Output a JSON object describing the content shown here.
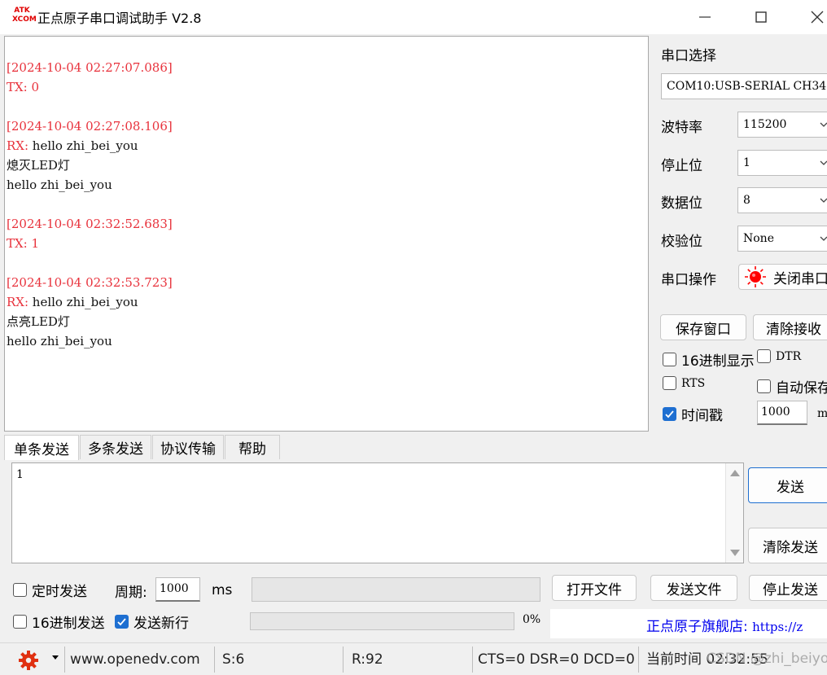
{
  "window": {
    "logo_line1": "ATK",
    "logo_line2": "XCOM",
    "title": "正点原子串口调试助手 V2.8"
  },
  "receive_log": [
    {
      "text": "[2024-10-04 02:27:07.086]",
      "color": "red"
    },
    {
      "text": "TX: 0",
      "color": "red"
    },
    {
      "text": "[2024-10-04 02:27:08.106]",
      "color": "red"
    },
    {
      "label": "RX:",
      "text": " hello zhi_bei_you"
    },
    {
      "text": "熄灭LED灯",
      "color": "black"
    },
    {
      "text": "hello zhi_bei_you",
      "color": "black"
    },
    {
      "text": "[2024-10-04 02:32:52.683]",
      "color": "red"
    },
    {
      "text": "TX: 1",
      "color": "red"
    },
    {
      "text": "[2024-10-04 02:32:53.723]",
      "color": "red"
    },
    {
      "label": "RX:",
      "text": " hello zhi_bei_you"
    },
    {
      "text": "点亮LED灯",
      "color": "black"
    },
    {
      "text": "hello zhi_bei_you",
      "color": "black"
    }
  ],
  "serial": {
    "port_label": "串口选择",
    "port_value": "COM10:USB-SERIAL CH34",
    "baud_label": "波特率",
    "baud_value": "115200",
    "stop_label": "停止位",
    "stop_value": "1",
    "data_label": "数据位",
    "data_value": "8",
    "parity_label": "校验位",
    "parity_value": "None",
    "op_label": "串口操作",
    "op_button": "关闭串口"
  },
  "rx_controls": {
    "save_window": "保存窗口",
    "clear_receive": "清除接收",
    "hex_display": "16进制显示",
    "dtr": "DTR",
    "rts": "RTS",
    "auto_save": "自动保存",
    "timestamp": "时间戳",
    "timestamp_value": "1000",
    "timestamp_unit": "ms"
  },
  "tabs": [
    "单条发送",
    "多条发送",
    "协议传输",
    "帮助"
  ],
  "send": {
    "text": "1",
    "send_button": "发送",
    "clear_send": "清除发送",
    "timed_send": "定时发送",
    "period_label": "周期:",
    "period_value": "1000",
    "period_unit": "ms",
    "open_file": "打开文件",
    "send_file": "发送文件",
    "stop_send": "停止发送",
    "hex_send": "16进制发送",
    "send_newline": "发送新行",
    "progress_text": "0%",
    "progress": 0,
    "ad_label": "正点原子旗舰店:",
    "ad_url": "https://z"
  },
  "status": {
    "website": "www.openedv.com",
    "sent": "S:6",
    "received": "R:92",
    "lines": "CTS=0 DSR=0 DCD=0",
    "time": "当前时间 02:32:55",
    "watermark": "CSDN @zhi_beiyou"
  },
  "colors": {
    "log_red": "#e8323c",
    "accent_blue": "#1e6fd1",
    "link_blue": "#0000ee",
    "led_red": "#ff0000"
  }
}
